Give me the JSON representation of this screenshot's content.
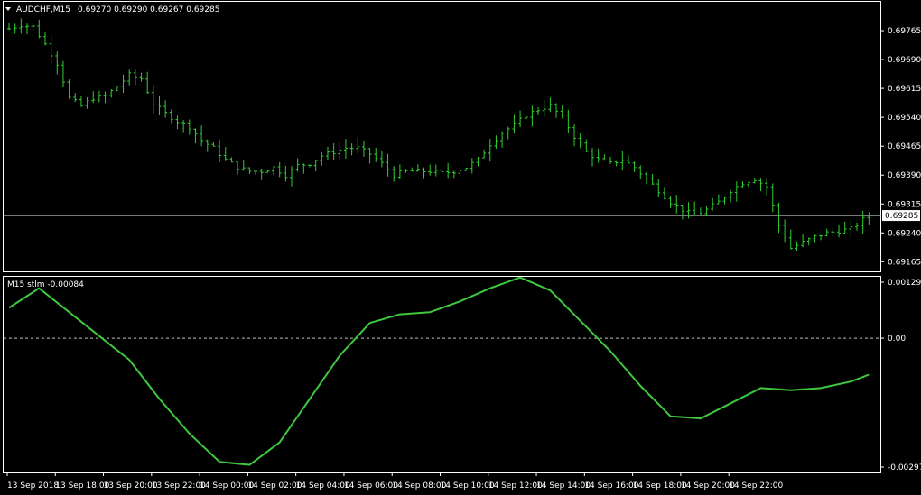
{
  "colors": {
    "background": "#000000",
    "frame": "#ffffff",
    "bars": "#32cd32",
    "indicator": "#3ec83e",
    "bid_line": "#c0c0c0",
    "zero_line": "#c0c0c0",
    "text": "#ffffff"
  },
  "chart_data": [
    {
      "type": "bar",
      "subtype": "ohlc",
      "symbol_header": "AUDCHF,M15",
      "header_values": [
        "0.69270",
        "0.69290",
        "0.69267",
        "0.69285"
      ],
      "ylim": [
        0.6914,
        0.6984
      ],
      "y_ticks": [
        "0.69765",
        "0.69690",
        "0.69615",
        "0.69540",
        "0.69465",
        "0.69390",
        "0.69315",
        "0.69240",
        "0.69165"
      ],
      "current_price_label": "0.69285",
      "current_price": 0.69285,
      "x_labels": [
        "13 Sep 2018",
        "13 Sep 18:00",
        "13 Sep 20:00",
        "13 Sep 22:00",
        "14 Sep 00:00",
        "14 Sep 02:00",
        "14 Sep 04:00",
        "14 Sep 06:00",
        "14 Sep 08:00",
        "14 Sep 10:00",
        "14 Sep 12:00",
        "14 Sep 14:00",
        "14 Sep 16:00",
        "14 Sep 18:00",
        "14 Sep 20:00",
        "14 Sep 22:00"
      ],
      "bars_per_label": 8,
      "close_path": [
        [
          0,
          0.6977
        ],
        [
          2,
          0.6978
        ],
        [
          4,
          0.69775
        ],
        [
          6,
          0.6973
        ],
        [
          8,
          0.6968
        ],
        [
          10,
          0.6959
        ],
        [
          12,
          0.6957
        ],
        [
          14,
          0.6959
        ],
        [
          16,
          0.69595
        ],
        [
          18,
          0.6962
        ],
        [
          20,
          0.6965
        ],
        [
          22,
          0.6964
        ],
        [
          24,
          0.69575
        ],
        [
          26,
          0.6955
        ],
        [
          28,
          0.6953
        ],
        [
          30,
          0.69515
        ],
        [
          32,
          0.6948
        ],
        [
          34,
          0.6946
        ],
        [
          36,
          0.6943
        ],
        [
          38,
          0.6941
        ],
        [
          40,
          0.694
        ],
        [
          42,
          0.694
        ],
        [
          44,
          0.6941
        ],
        [
          46,
          0.6939
        ],
        [
          48,
          0.69415
        ],
        [
          50,
          0.6942
        ],
        [
          52,
          0.6944
        ],
        [
          54,
          0.6945
        ],
        [
          56,
          0.6946
        ],
        [
          58,
          0.6946
        ],
        [
          60,
          0.69445
        ],
        [
          62,
          0.6942
        ],
        [
          64,
          0.6939
        ],
        [
          66,
          0.694
        ],
        [
          68,
          0.694
        ],
        [
          70,
          0.694
        ],
        [
          72,
          0.69395
        ],
        [
          74,
          0.694
        ],
        [
          76,
          0.6941
        ],
        [
          78,
          0.6943
        ],
        [
          80,
          0.6947
        ],
        [
          82,
          0.695
        ],
        [
          84,
          0.6952
        ],
        [
          86,
          0.69545
        ],
        [
          88,
          0.6956
        ],
        [
          90,
          0.6957
        ],
        [
          92,
          0.6954
        ],
        [
          94,
          0.6949
        ],
        [
          96,
          0.6945
        ],
        [
          98,
          0.6943
        ],
        [
          100,
          0.6942
        ],
        [
          102,
          0.6943
        ],
        [
          104,
          0.6941
        ],
        [
          106,
          0.6938
        ],
        [
          108,
          0.6935
        ],
        [
          110,
          0.6932
        ],
        [
          112,
          0.693
        ],
        [
          114,
          0.69285
        ],
        [
          116,
          0.693
        ],
        [
          118,
          0.6932
        ],
        [
          120,
          0.6935
        ],
        [
          122,
          0.6937
        ],
        [
          124,
          0.6938
        ],
        [
          126,
          0.6936
        ],
        [
          128,
          0.6926
        ],
        [
          130,
          0.692
        ],
        [
          132,
          0.69215
        ],
        [
          134,
          0.6923
        ],
        [
          136,
          0.6924
        ],
        [
          138,
          0.69245
        ],
        [
          140,
          0.6925
        ],
        [
          142,
          0.69275
        ],
        [
          143,
          0.69285
        ]
      ]
    },
    {
      "type": "line",
      "label": "M15 stlm -0.00084",
      "ylim": [
        -0.00297,
        0.00129
      ],
      "y_ticks": [
        "0.00129",
        "0.00",
        "-0.00297"
      ],
      "zero_line": 0.0,
      "x": [
        0,
        5,
        10,
        15,
        20,
        25,
        30,
        35,
        40,
        45,
        50,
        55,
        60,
        65,
        70,
        75,
        80,
        85,
        90,
        95,
        100,
        105,
        110,
        115,
        120,
        125,
        130,
        135,
        140,
        143
      ],
      "values": [
        0.0007,
        0.00115,
        0.0006,
        5e-05,
        -0.0005,
        -0.0014,
        -0.0022,
        -0.00285,
        -0.00292,
        -0.0024,
        -0.0014,
        -0.0004,
        0.00035,
        0.00055,
        0.0006,
        0.00085,
        0.00115,
        0.0014,
        0.0011,
        0.0004,
        -0.0003,
        -0.0011,
        -0.0018,
        -0.00185,
        -0.0015,
        -0.00115,
        -0.0012,
        -0.00115,
        -0.001,
        -0.00084
      ]
    }
  ]
}
